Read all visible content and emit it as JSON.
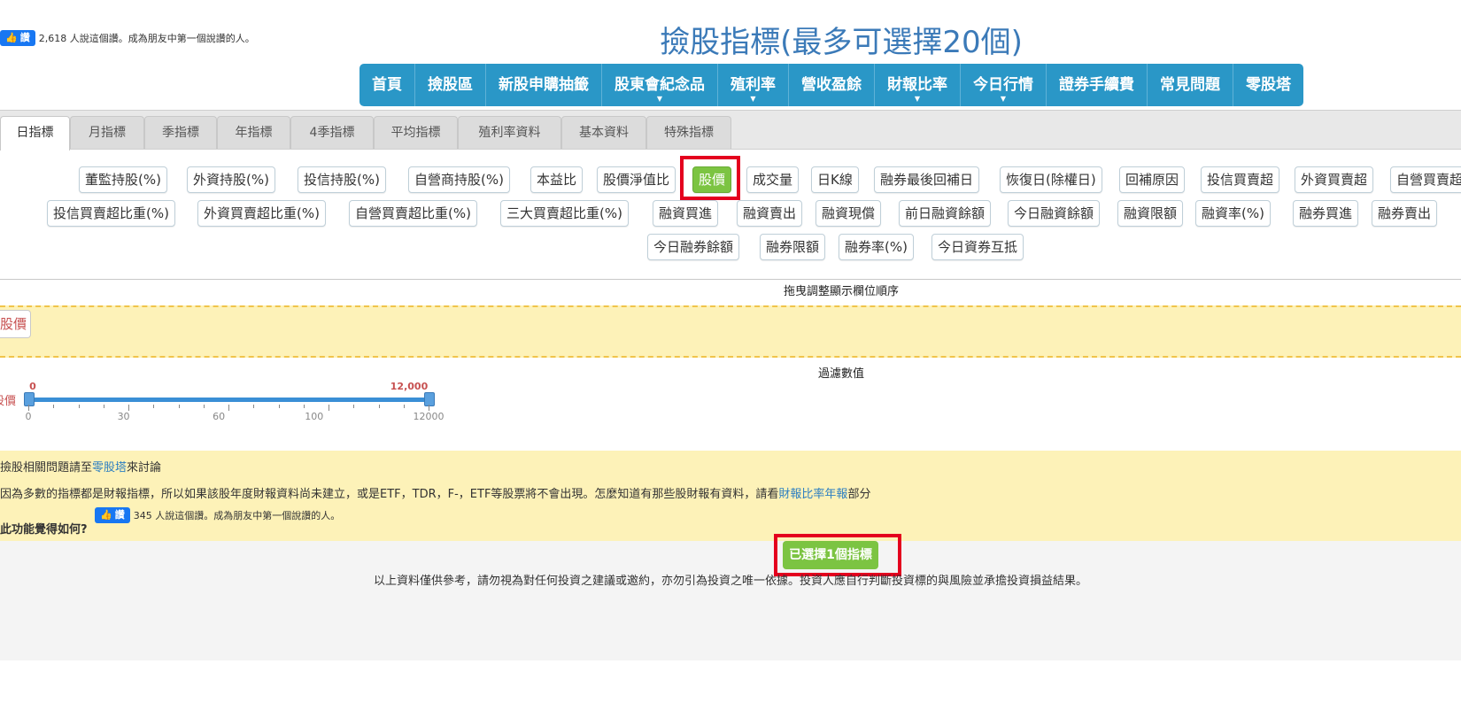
{
  "top_like": {
    "button": "讚",
    "text": "2,618 人說這個讚。成為朋友中第一個說讚的人。"
  },
  "page_title": "撿股指標(最多可選擇20個)",
  "nav": [
    {
      "label": "首頁"
    },
    {
      "label": "撿股區"
    },
    {
      "label": "新股申購抽籤"
    },
    {
      "label": "股東會紀念品",
      "caret": "▼"
    },
    {
      "label": "殖利率",
      "caret": "▼"
    },
    {
      "label": "營收盈餘"
    },
    {
      "label": "財報比率",
      "caret": "▼"
    },
    {
      "label": "今日行情",
      "caret": "▼"
    },
    {
      "label": "證券手續費"
    },
    {
      "label": "常見問題"
    },
    {
      "label": "零股塔"
    }
  ],
  "tabs": [
    "日指標",
    "月指標",
    "季指標",
    "年指標",
    "4季指標",
    "平均指標",
    "殖利率資料",
    "基本資料",
    "特殊指標"
  ],
  "indicators_row1": [
    "董監持股(%)",
    "外資持股(%)",
    "投信持股(%)",
    "自營商持股(%)",
    "本益比",
    "股價淨值比",
    "股價",
    "成交量",
    "日K線",
    "融券最後回補日",
    "恢復日(除權日)",
    "回補原因",
    "投信買賣超",
    "外資買賣超",
    "自營買賣超"
  ],
  "indicators_row2": [
    "投信買賣超比重(%)",
    "外資買賣超比重(%)",
    "自營買賣超比重(%)",
    "三大買賣超比重(%)",
    "融資買進",
    "融資賣出",
    "融資現償",
    "前日融資餘額",
    "今日融資餘額",
    "融資限額",
    "融資率(%)",
    "融券買進",
    "融券賣出"
  ],
  "indicators_row3": [
    "今日融券餘額",
    "融券限額",
    "融券率(%)",
    "今日資券互抵"
  ],
  "selected_indicator": "股價",
  "drag_section": {
    "label": "拖曳調整顯示欄位順序",
    "chip": "股價"
  },
  "filter_section": {
    "label": "過濾數值",
    "row_label": "股價",
    "range_min_label": "0",
    "range_max_label": "12,000",
    "range_fraction": [
      0,
      1
    ],
    "ticks": [
      "0",
      "30",
      "60",
      "100",
      "12000"
    ]
  },
  "info": {
    "line1_prefix": "撿股相關問題請至",
    "line1_link": "零股塔",
    "line1_suffix": "來討論",
    "line2_prefix": "因為多數的指標都是財報指標，所以如果該股年度財報資料尚未建立，或是ETF，TDR，F-，ETF等股票將不會出現。怎麼知道有那些股財報有資料，請看",
    "line2_link": "財報比率年報",
    "line2_suffix": "部分",
    "line3_label": "此功能覺得如何?",
    "like_button": "讚",
    "like_text": "345 人說這個讚。成為朋友中第一個說讚的人。"
  },
  "selected_button": "已選擇1個指標",
  "disclaimer": "以上資料僅供參考，請勿視為對任何投資之建議或邀約，亦勿引為投資之唯一依據。投資人應自行判斷投資標的與風險並承擔投資損益結果。",
  "colors": {
    "nav_bg": "#2a97c7",
    "selected_green": "#7cc442",
    "highlight_red": "#e4001e",
    "title_blue": "#3b7ab8",
    "info_bg": "#fdf2b8"
  }
}
